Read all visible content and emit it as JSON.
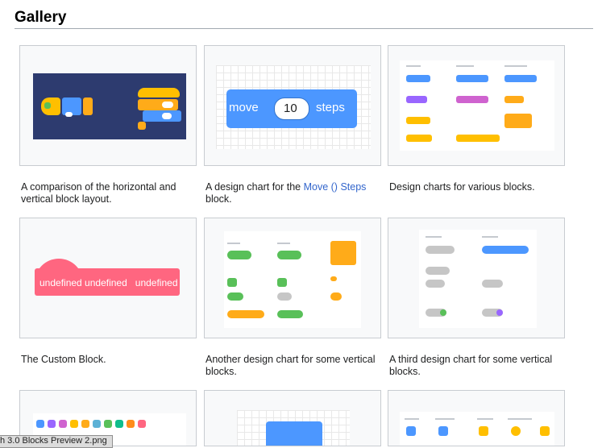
{
  "page": {
    "title": "Gallery"
  },
  "gallery": [
    {
      "caption": "A comparison of the horizontal and vertical block layout."
    },
    {
      "caption_prefix": "A design chart for the ",
      "caption_link": "Move () Steps",
      "caption_suffix": " block.",
      "block_word1": "move",
      "block_value": "10",
      "block_word2": "steps"
    },
    {
      "caption": "Design charts for various blocks."
    },
    {
      "caption": "The Custom Block.",
      "block_text": "undefined undefined   undefined"
    },
    {
      "caption": "Another design chart for some vertical blocks."
    },
    {
      "caption": "A third design chart for some vertical blocks."
    }
  ],
  "status_bar": {
    "text": "h 3.0 Blocks Preview 2.png"
  },
  "colors": {
    "motion_blue": "#4c97ff",
    "events_yellow": "#ffbf00",
    "control_orange": "#ffab19",
    "custom_pink": "#ff6680",
    "green": "#59c059",
    "purple": "#9966ff"
  }
}
